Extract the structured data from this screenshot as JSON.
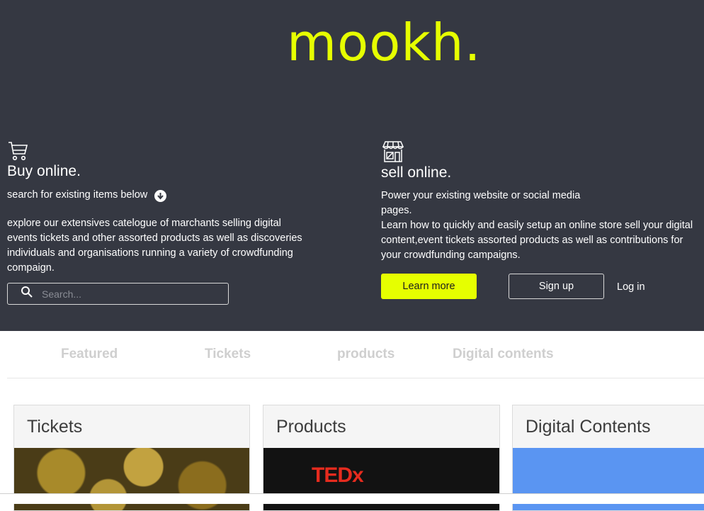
{
  "brand": {
    "logo_text": "mookh.",
    "accent": "#e6ff00",
    "background": "#353842"
  },
  "buy": {
    "icon": "cart-icon",
    "title": "Buy online.",
    "subtitle": "search for existing items below",
    "description": "explore our extensives catelogue of marchants selling digital events tickets and other assorted products as well as discoveries individuals and organisations running a variety of crowdfunding compaign.",
    "search_placeholder": "Search..."
  },
  "sell": {
    "icon": "storefront-icon",
    "title": "sell online.",
    "line1": "Power your existing website or social media",
    "line2": "pages.",
    "line3": "Learn how to quickly and easily setup an online store sell your digital content,event tickets assorted products as well as contributions for your crowdfunding campaigns.",
    "learn_more": "Learn more",
    "sign_up": "Sign up",
    "log_in": "Log in"
  },
  "tabs": [
    "Featured",
    "Tickets",
    "products",
    "Digital contents"
  ],
  "cards": [
    {
      "title": "Tickets"
    },
    {
      "title": "Products",
      "image_text": "TEDx"
    },
    {
      "title": "Digital Contents"
    }
  ]
}
